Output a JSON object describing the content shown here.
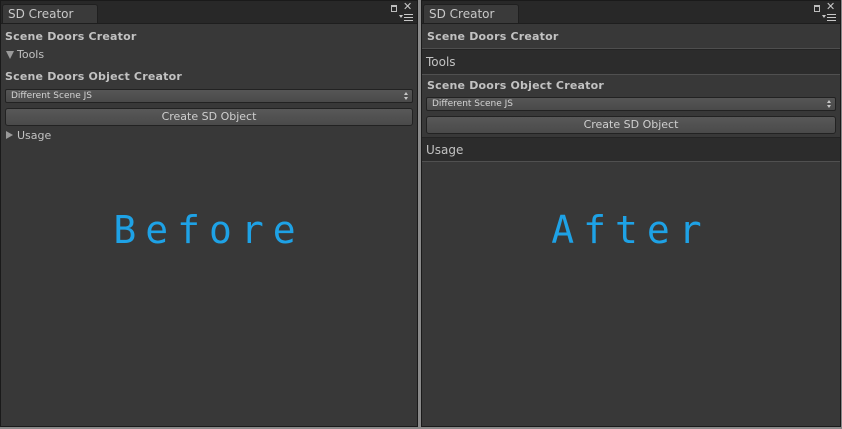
{
  "panels": [
    {
      "tab_title": "SD Creator",
      "heading": "Scene Doors Creator",
      "tools_label": "Tools",
      "object_creator_heading": "Scene Doors Object Creator",
      "dropdown_value": "Different Scene JS",
      "create_button_label": "Create SD Object",
      "usage_label": "Usage",
      "caption": "Before"
    },
    {
      "tab_title": "SD Creator",
      "heading": "Scene Doors Creator",
      "tools_label": "Tools",
      "object_creator_heading": "Scene Doors Object Creator",
      "dropdown_value": "Different Scene JS",
      "create_button_label": "Create SD Object",
      "usage_label": "Usage",
      "caption": "After"
    }
  ],
  "icons": {
    "tools_foldout": "triangle-down-icon",
    "usage_foldout": "triangle-right-icon",
    "dropdown": "up-down-arrows-icon",
    "window_maximize": "maximize-icon",
    "window_close": "close-icon",
    "window_menu": "menu-icon"
  },
  "colors": {
    "panel_background": "#383838",
    "caption_accent": "#1ea2e6"
  }
}
